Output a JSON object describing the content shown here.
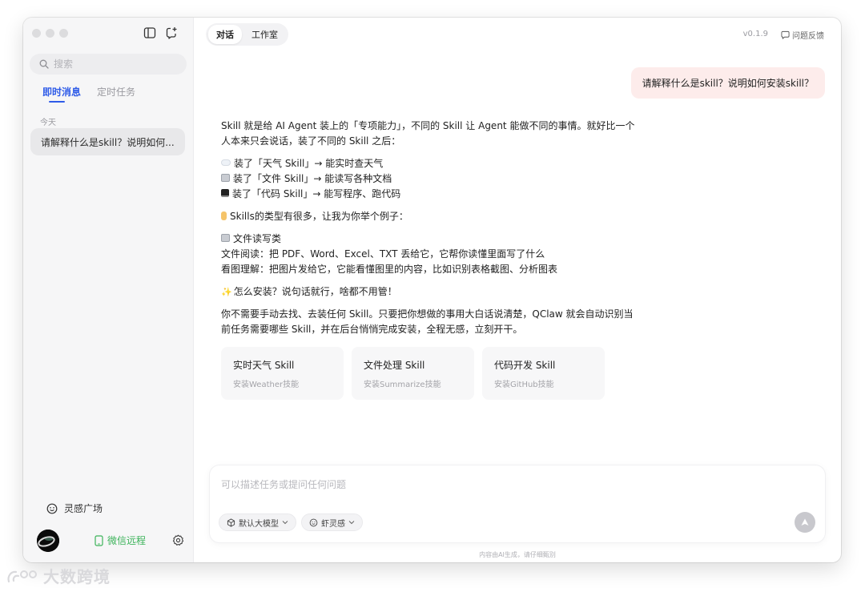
{
  "sidebar": {
    "search_placeholder": "搜索",
    "tabs": [
      "即时消息",
      "定时任务"
    ],
    "date_label": "今天",
    "chat_item": "请解释什么是skill？说明如何...",
    "plaza_label": "灵感广场",
    "wechat_label": "微信远程"
  },
  "header": {
    "tabs": [
      "对话",
      "工作室"
    ],
    "version": "v0.1.9",
    "feedback": "问题反馈"
  },
  "conversation": {
    "user_message": "请解释什么是skill？说明如何安装skill？",
    "answer": {
      "intro": "Skill 就是给 AI Agent 装上的「专项能力」，不同的 Skill 让 Agent 能做不同的事情。就好比一个人本来只会说话，装了不同的 Skill 之后：",
      "examples": [
        "装了「天气 Skill」→ 能实时查天气",
        "装了「文件 Skill」→ 能读写各种文档",
        "装了「代码 Skill」→ 能写程序、跑代码"
      ],
      "types_heading": "Skills的类型有很多，让我为你举个例子：",
      "category_title": "文件读写类",
      "category_lines": [
        "文件阅读：把 PDF、Word、Excel、TXT 丢给它，它帮你读懂里面写了什么",
        "看图理解：把图片发给它，它能看懂图里的内容，比如识别表格截图、分析图表"
      ],
      "install_heading": "怎么安装？说句话就行，啥都不用管！",
      "install_body": "你不需要手动去找、去装任何 Skill。只要把你想做的事用大白话说清楚，QClaw 就会自动识别当前任务需要哪些 Skill，并在后台悄悄完成安装，全程无感，立刻开干。"
    },
    "cards": [
      {
        "title": "实时天气 Skill",
        "subtitle": "安装Weather技能"
      },
      {
        "title": "文件处理 Skill",
        "subtitle": "安装Summarize技能"
      },
      {
        "title": "代码开发 Skill",
        "subtitle": "安装GitHub技能"
      }
    ]
  },
  "composer": {
    "placeholder": "可以描述任务或提问任何问题",
    "model_label": "默认大模型",
    "inspiration_label": "虾灵感",
    "disclaimer": "内容由AI生成，请仔细甄别"
  },
  "watermark": "大数跨境",
  "colors": {
    "accent": "#2e5be8",
    "user_bubble": "#fdeceb",
    "wechat": "#3cb35a"
  }
}
